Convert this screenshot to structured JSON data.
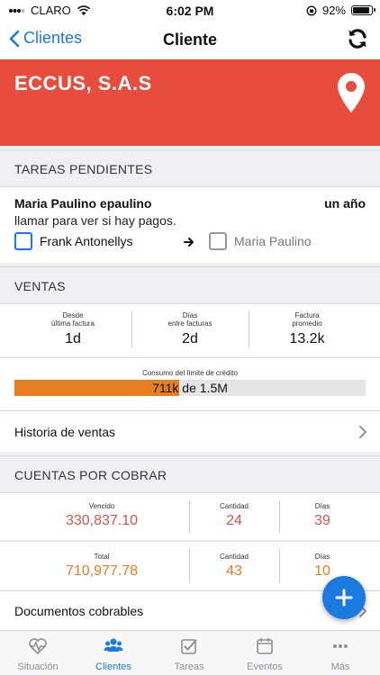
{
  "status_bar": {
    "carrier": "CLARO",
    "time": "6:02 PM",
    "battery": "92%"
  },
  "nav": {
    "back_label": "Clientes",
    "title": "Cliente"
  },
  "client": {
    "name": "ECCUS, S.A.S"
  },
  "colors": {
    "brand_red": "#e74c3c",
    "accent_blue": "#1a7ae0",
    "orange": "#e67e22",
    "value_red": "#d9534f"
  },
  "tareas": {
    "header": "TAREAS PENDIENTES",
    "task": {
      "title": "Maria Paulino epaulino",
      "time": "un año",
      "description": "llamar para ver si hay pagos.",
      "from": "Frank Antonellys",
      "to": "Maria Paulino"
    }
  },
  "ventas": {
    "header": "VENTAS",
    "stats": [
      {
        "label_line1": "Desde",
        "label_line2": "última factura",
        "value": "1d"
      },
      {
        "label_line1": "Días",
        "label_line2": "entre facturas",
        "value": "2d"
      },
      {
        "label_line1": "Factura",
        "label_line2": "promedio",
        "value": "13.2k"
      }
    ],
    "credit": {
      "label": "Consumo del límite de crédito",
      "text": "711k de 1.5M",
      "fraction": 0.47
    },
    "history_label": "Historia de ventas"
  },
  "cuentas": {
    "header": "CUENTAS POR COBRAR",
    "rows": [
      {
        "label": "Vencido",
        "amount": "330,837.10",
        "qty_label": "Cantidad",
        "qty": "24",
        "days_label": "Días",
        "days": "39"
      },
      {
        "label": "Total",
        "amount": "710,977.78",
        "qty_label": "Cantidad",
        "qty": "43",
        "days_label": "Días",
        "days": "10"
      }
    ],
    "documents_label": "Documentos cobrables"
  },
  "tabs": [
    {
      "label": "Situación",
      "icon": "heartbeat-icon",
      "active": false
    },
    {
      "label": "Clientes",
      "icon": "users-icon",
      "active": true
    },
    {
      "label": "Tareas",
      "icon": "checklist-icon",
      "active": false
    },
    {
      "label": "Eventos",
      "icon": "calendar-icon",
      "active": false
    },
    {
      "label": "Más",
      "icon": "more-icon",
      "active": false
    }
  ]
}
